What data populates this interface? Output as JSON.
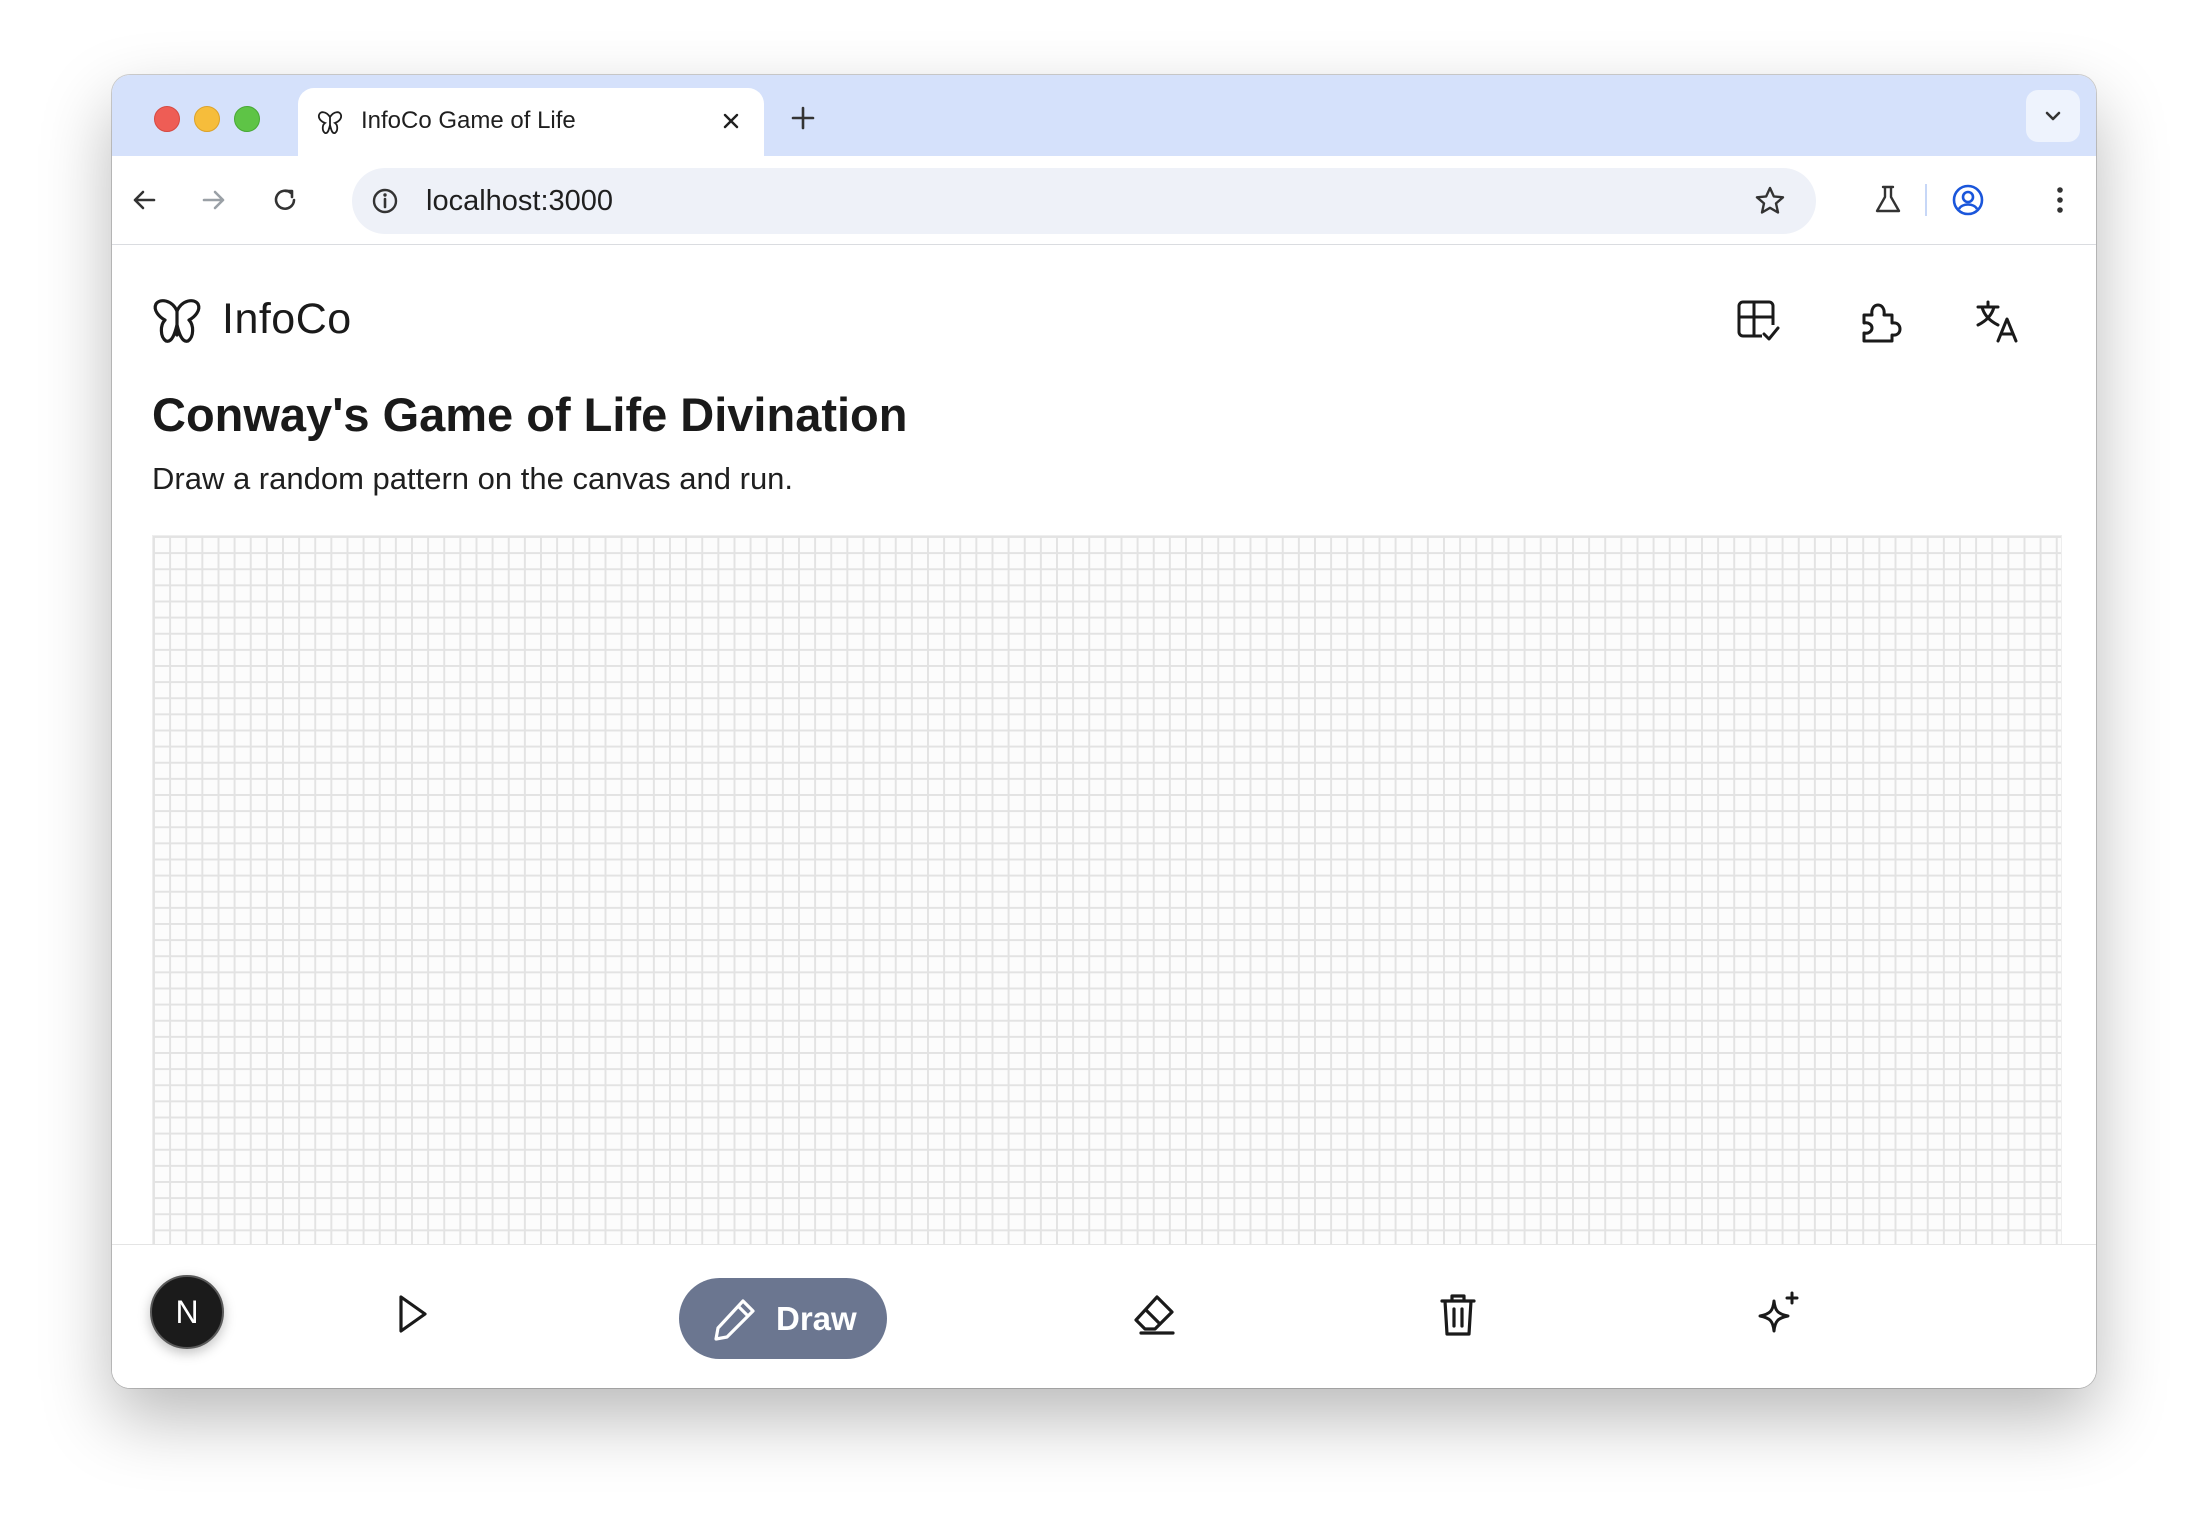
{
  "browser": {
    "tab_title": "InfoCo Game of Life",
    "url": "localhost:3000",
    "traffic_colors": {
      "close": "#ee5d55",
      "minimize": "#f6bd3b",
      "zoom": "#5ec446"
    }
  },
  "header": {
    "brand": "InfoCo",
    "icons": [
      "layout-check-icon",
      "puzzle-piece-icon",
      "translate-icon"
    ]
  },
  "main": {
    "title": "Conway's Game of Life Divination",
    "subtitle": "Draw a random pattern on the canvas and run."
  },
  "bottom_bar": {
    "avatar_letter": "N",
    "draw_label": "Draw",
    "active_tool": "draw",
    "active_color": "#6b7690"
  }
}
